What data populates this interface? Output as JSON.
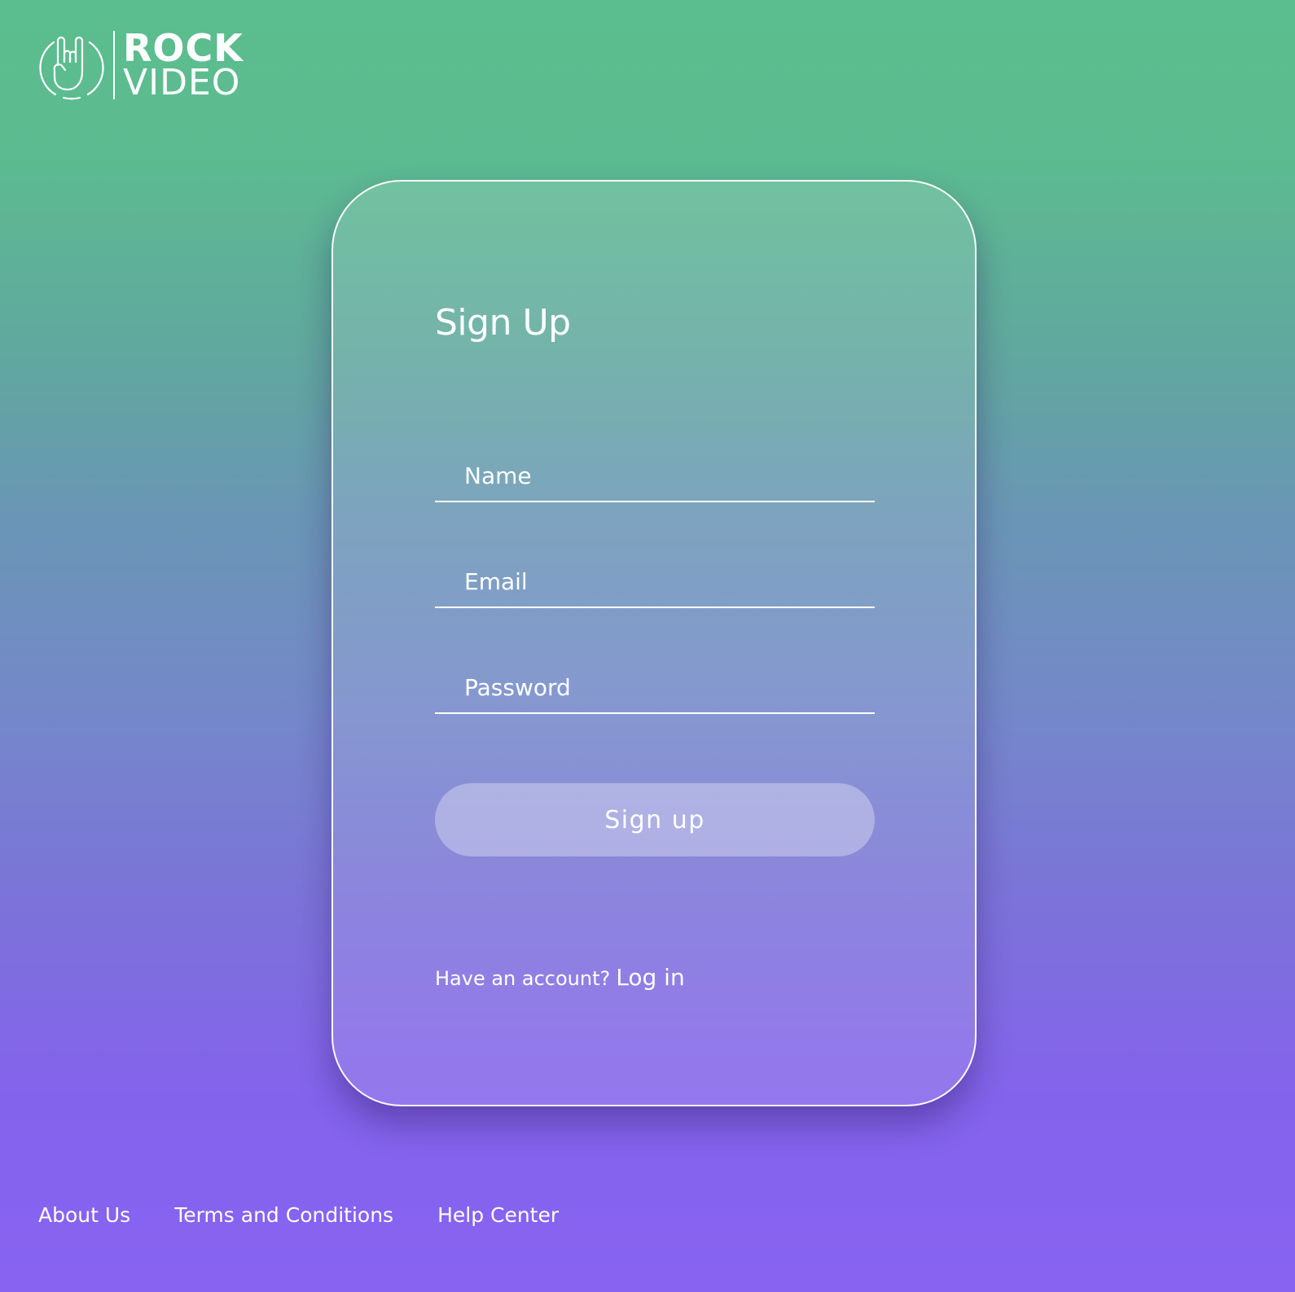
{
  "brand": {
    "icon": "rock-hand-icon",
    "word_top": "ROCK",
    "word_bottom": "VIDEO"
  },
  "signup_card": {
    "title": "Sign Up",
    "fields": {
      "name_placeholder": "Name",
      "name_value": "",
      "email_placeholder": "Email",
      "email_value": "",
      "password_placeholder": "Password",
      "password_value": ""
    },
    "submit_label": "Sign up",
    "login_prompt": "Have an account?",
    "login_link": "Log in"
  },
  "footer": {
    "links": [
      "About Us",
      "Terms and Conditions",
      "Help Center"
    ]
  },
  "colors": {
    "gradient_top": "#5bbe8e",
    "gradient_mid": "#6a96b5",
    "gradient_bottom": "#8863f2",
    "text": "#ffffff"
  }
}
